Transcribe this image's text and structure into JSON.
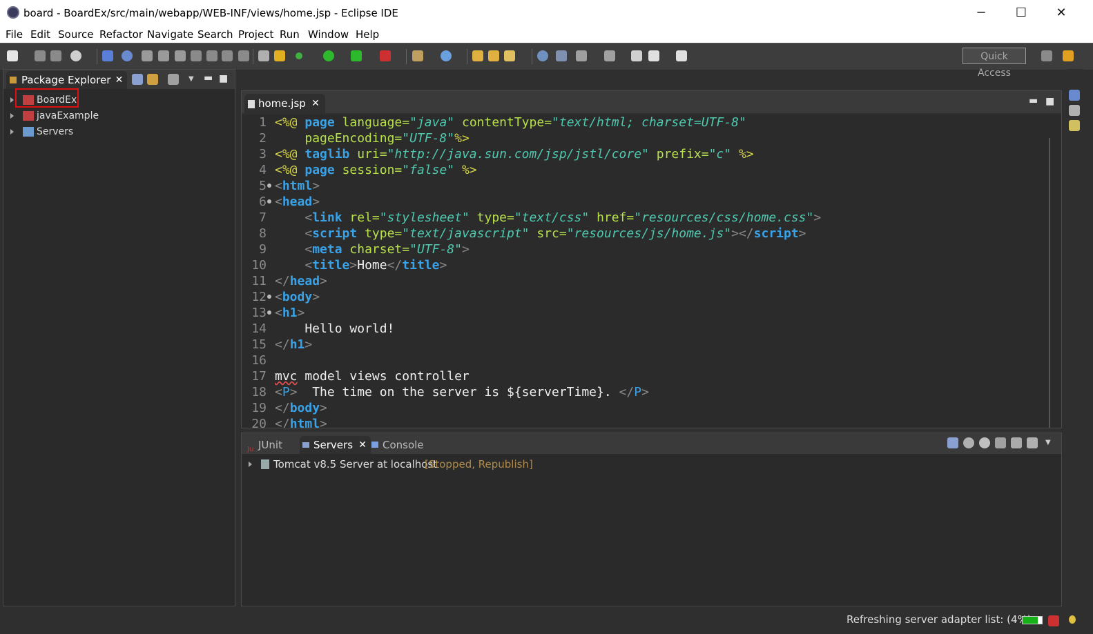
{
  "window": {
    "title": "board - BoardEx/src/main/webapp/WEB-INF/views/home.jsp - Eclipse IDE",
    "minimize": "─",
    "maximize": "☐",
    "close": "✕"
  },
  "menu": [
    "File",
    "Edit",
    "Source",
    "Refactor",
    "Navigate",
    "Search",
    "Project",
    "Run",
    "Window",
    "Help"
  ],
  "toolbar": {
    "quick_access_placeholder": "Quick Access"
  },
  "package_explorer": {
    "title": "Package Explorer",
    "close": "✕",
    "items": [
      {
        "label": "BoardEx",
        "icon": "project-icon",
        "highlighted": true
      },
      {
        "label": "javaExample",
        "icon": "project-icon",
        "highlighted": false
      },
      {
        "label": "Servers",
        "icon": "folder-icon",
        "highlighted": false
      }
    ]
  },
  "editor": {
    "tab_label": "home.jsp",
    "tab_close": "✕",
    "line_numbers": [
      "1",
      "2",
      "3",
      "4",
      "5",
      "6",
      "7",
      "8",
      "9",
      "10",
      "11",
      "12",
      "13",
      "14",
      "15",
      "16",
      "17",
      "18",
      "19",
      "20"
    ]
  },
  "bottom_panel": {
    "tabs": [
      {
        "label": "JUnit",
        "icon": "junit-icon"
      },
      {
        "label": "Servers",
        "icon": "servers-icon"
      },
      {
        "label": "Console",
        "icon": "console-icon"
      }
    ],
    "tab_close": "✕",
    "server_name": "Tomcat v8.5 Server at localhost",
    "server_status": "[Stopped, Republish]"
  },
  "status": {
    "text": "Refreshing server adapter list: (4%)",
    "progress_percent": 4
  },
  "colors": {
    "tag": "#3aa3e8",
    "attr": "#b7e14a",
    "string": "#4ec9b0",
    "directive": "#d4d44a",
    "highlight_box": "#e01010",
    "server_status": "#b08a4a"
  }
}
